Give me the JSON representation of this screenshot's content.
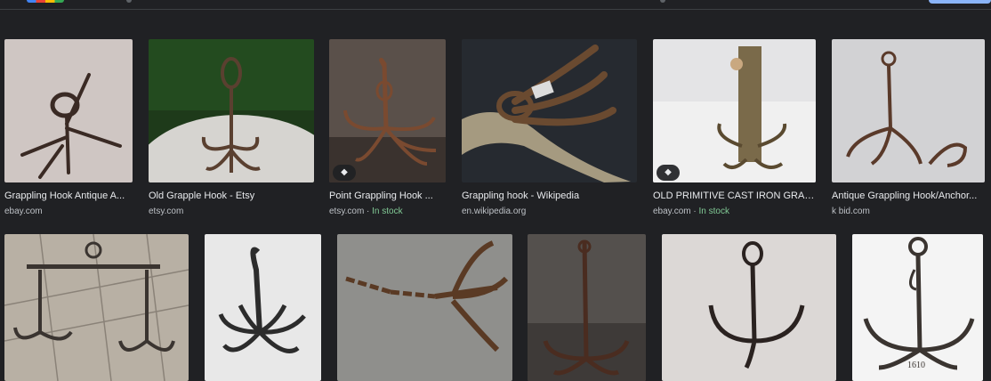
{
  "results_row1": [
    {
      "title": "Grappling Hook Antique A...",
      "source": "ebay.com",
      "stock": "",
      "badge": false
    },
    {
      "title": "Old Grapple Hook - Etsy",
      "source": "etsy.com",
      "stock": "",
      "badge": false
    },
    {
      "title": "Point Grappling Hook ...",
      "source": "etsy.com · ",
      "stock": "In stock",
      "badge": true
    },
    {
      "title": "Grappling hook - Wikipedia",
      "source": "en.wikipedia.org",
      "stock": "",
      "badge": false
    },
    {
      "title": "OLD PRIMITIVE CAST IRON GRAP...",
      "source": "ebay.com · ",
      "stock": "In stock",
      "badge": true
    },
    {
      "title": "Antique Grappling Hook/Anchor...",
      "source": "k bid.com",
      "stock": "",
      "badge": false
    }
  ],
  "results_row2": [
    {
      "alt": "double hook hanger"
    },
    {
      "alt": "six prong hook"
    },
    {
      "alt": "hook with chain"
    },
    {
      "alt": "rusty anchor hook"
    },
    {
      "alt": "three prong hook"
    },
    {
      "alt": "four prong hook",
      "caption": "1610"
    }
  ],
  "badge_icon": "tag-icon",
  "colors": {
    "background": "#202124",
    "title": "#e8eaed",
    "source": "#bdc1c6",
    "in_stock": "#81c995"
  }
}
